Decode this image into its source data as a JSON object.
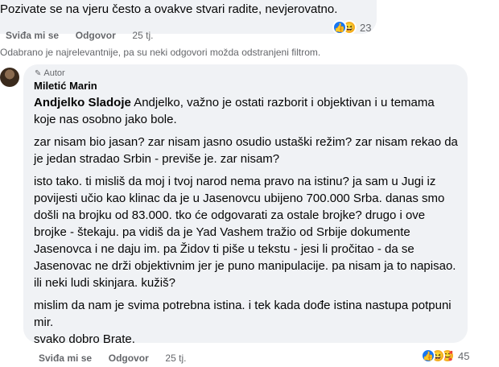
{
  "top_comment": {
    "text": "Pozivate se na vjeru često a ovakve stvari radite, nevjerovatno.",
    "actions": {
      "like": "Sviđa mi se",
      "reply": "Odgovor",
      "time": "25 tj."
    },
    "reactions": {
      "count": "23",
      "icons": [
        "like-icon",
        "haha-icon"
      ]
    }
  },
  "filter_notice": "Odabrano je najrelevantnije, pa su neki odgovori možda odstranjeni filtrom.",
  "reply": {
    "badge": "Autor",
    "author": "Miletić Marin",
    "mention": "Andjelko Sladoje",
    "lines": [
      " Andjelko, važno je ostati razborit i objektivan i u temama",
      "koje nas osobno jako bole.",
      "zar nisam bio jasan? zar nisam jasno osudio ustaški režim? zar nisam rekao da",
      "je jedan stradao Srbin - previše je. zar nisam?",
      "isto tako. ti misliš da moj i tvoj narod nema pravo na istinu? ja sam u Jugi iz",
      "povijesti učio kao klinac da je u Jasenovcu ubijeno 700.000 Srba. danas smo",
      "došli na brojku od 83.000. tko će odgovarati za ostale brojke? drugo i ove",
      "brojke - štekaju. pa vidiš da je Yad Vashem tražio od Srbije dokumente",
      "Jasenovca i ne daju im. pa Židov ti piše u tekstu - jesi li pročitao - da se",
      "Jasenovac ne drži objektivnim jer je puno manipulacije. pa nisam ja to napisao.",
      "ili neki ludi skinjara. kužiš?",
      "mislim da nam je svima potrebna istina. i tek kada dođe istina nastupa potpuni",
      "mir.",
      "svako dobro Brate."
    ],
    "actions": {
      "like": "Sviđa mi se",
      "reply": "Odgovor",
      "time": "25 tj."
    },
    "reactions": {
      "count": "45",
      "icons": [
        "like-icon",
        "haha-icon",
        "care-icon"
      ]
    }
  }
}
